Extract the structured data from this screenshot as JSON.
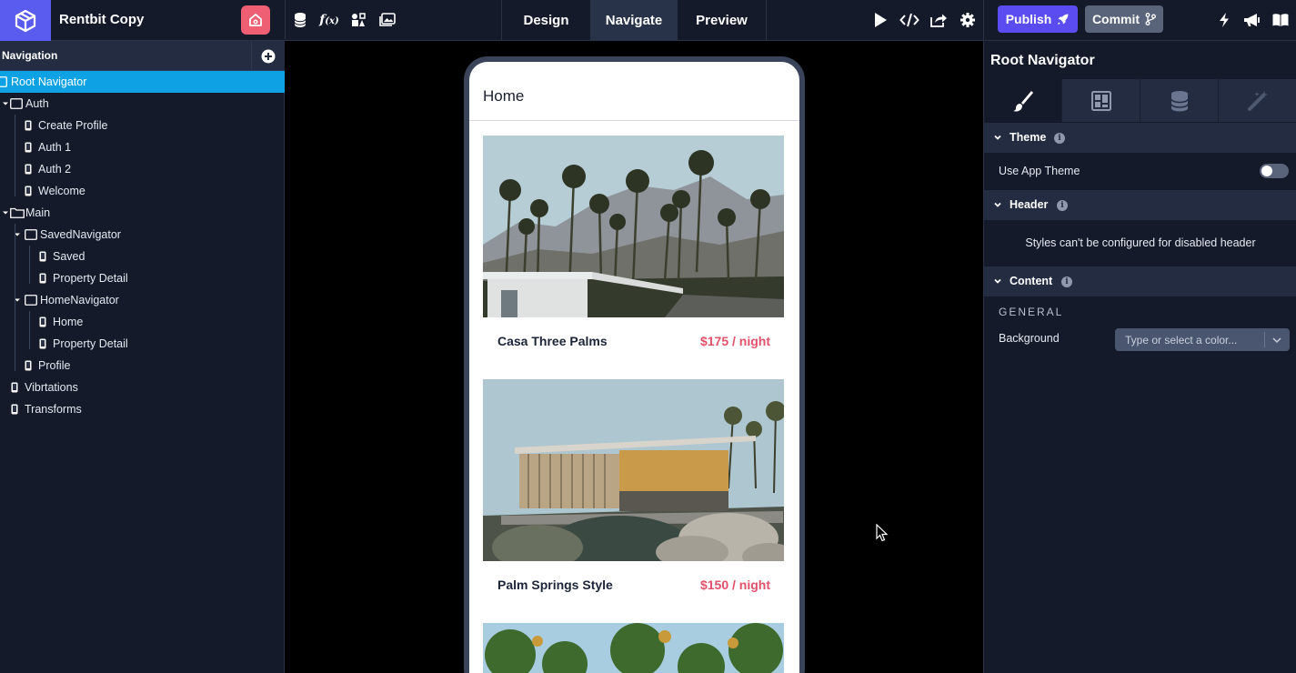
{
  "project": {
    "name": "Rentbit Copy"
  },
  "topbar": {
    "modes": [
      "Design",
      "Navigate",
      "Preview"
    ],
    "active_mode": "Navigate",
    "publish_label": "Publish",
    "commit_label": "Commit"
  },
  "navigation": {
    "title": "Navigation",
    "tree": [
      {
        "label": "Root Navigator",
        "depth": 0,
        "kind": "navigator",
        "selected": true
      },
      {
        "label": "Auth",
        "depth": 0,
        "kind": "navigator",
        "expanded": true
      },
      {
        "label": "Create Profile",
        "depth": 1,
        "kind": "screen"
      },
      {
        "label": "Auth 1",
        "depth": 1,
        "kind": "screen"
      },
      {
        "label": "Auth 2",
        "depth": 1,
        "kind": "screen"
      },
      {
        "label": "Welcome",
        "depth": 1,
        "kind": "screen"
      },
      {
        "label": "Main",
        "depth": 0,
        "kind": "folder",
        "expanded": true
      },
      {
        "label": "SavedNavigator",
        "depth": 1,
        "kind": "navigator",
        "expanded": true
      },
      {
        "label": "Saved",
        "depth": 2,
        "kind": "screen"
      },
      {
        "label": "Property Detail",
        "depth": 2,
        "kind": "screen"
      },
      {
        "label": "HomeNavigator",
        "depth": 1,
        "kind": "navigator",
        "expanded": true
      },
      {
        "label": "Home",
        "depth": 2,
        "kind": "screen"
      },
      {
        "label": "Property Detail",
        "depth": 2,
        "kind": "screen"
      },
      {
        "label": "Profile",
        "depth": 1,
        "kind": "screen"
      },
      {
        "label": "Vibrtations",
        "depth": 0,
        "kind": "screen"
      },
      {
        "label": "Transforms",
        "depth": 0,
        "kind": "screen"
      }
    ]
  },
  "preview": {
    "screen_title": "Home",
    "listings": [
      {
        "name": "Casa Three Palms",
        "price": "$175 / night"
      },
      {
        "name": "Palm Springs Style",
        "price": "$150 / night"
      }
    ]
  },
  "inspector": {
    "title": "Root Navigator",
    "sections": {
      "theme": {
        "title": "Theme",
        "use_app_theme_label": "Use App Theme",
        "use_app_theme": false
      },
      "header": {
        "title": "Header",
        "message": "Styles can't be configured for disabled header"
      },
      "content": {
        "title": "Content",
        "general_label": "GENERAL",
        "background_label": "Background",
        "background_placeholder": "Type or select a color..."
      }
    }
  },
  "colors": {
    "brand": "#5a5cf0",
    "selection": "#0ea2e4",
    "price": "#e2516a",
    "home_button": "#ee5f73",
    "panel_bg": "#141a29"
  }
}
